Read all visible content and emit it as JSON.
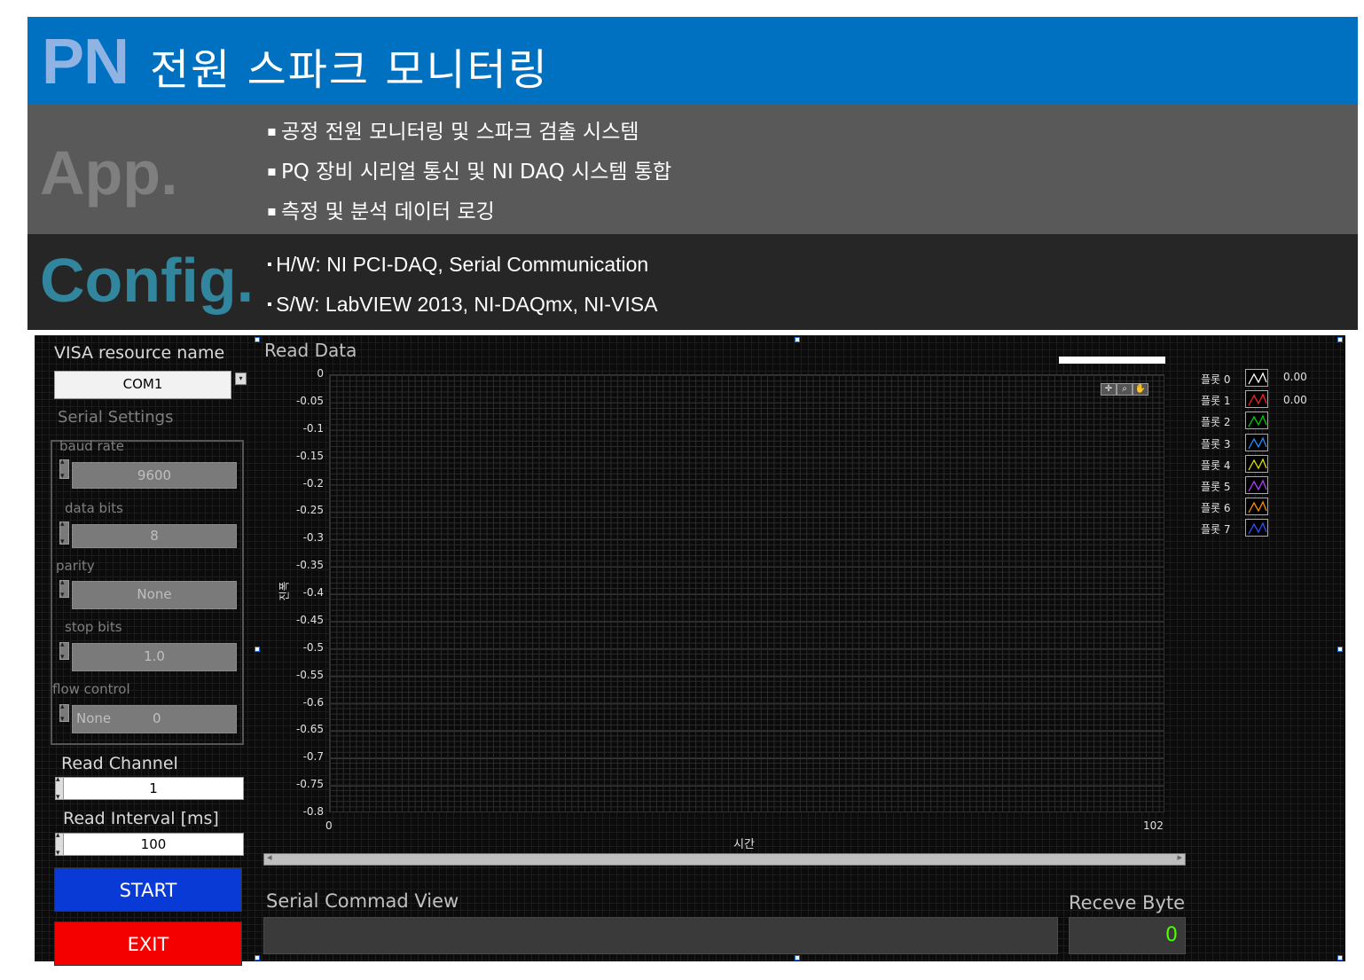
{
  "header": {
    "logo": "PN",
    "title": "전원 스파크 모니터링"
  },
  "app": {
    "label": "App.",
    "bullets": [
      "공정 전원 모니터링 및 스파크 검출 시스템",
      "PQ 장비 시리얼 통신 및 NI DAQ 시스템 통합",
      "측정 및 분석 데이터 로깅"
    ]
  },
  "config": {
    "label": "Config.",
    "bullets": [
      "H/W: NI PCI-DAQ, Serial Communication",
      "S/W: LabVIEW 2013, NI-DAQmx, NI-VISA"
    ]
  },
  "visa": {
    "label": "VISA resource name",
    "value": "COM1"
  },
  "serial": {
    "title": "Serial Settings",
    "baud_label": "baud rate",
    "baud": "9600",
    "data_bits_label": "data bits",
    "data_bits": "8",
    "parity_label": "parity",
    "parity": "None",
    "stop_bits_label": "stop bits",
    "stop_bits": "1.0",
    "flow_label": "flow control",
    "flow": "None",
    "flow_num": "0"
  },
  "read_channel": {
    "label": "Read Channel",
    "value": "1"
  },
  "read_interval": {
    "label": "Read Interval [ms]",
    "value": "100"
  },
  "buttons": {
    "start": "START",
    "exit": "EXIT"
  },
  "graph": {
    "title": "Read Data"
  },
  "chart_data": {
    "type": "line",
    "title": "Read Data",
    "xlabel": "시간",
    "ylabel": "진폭",
    "xlim": [
      0,
      102
    ],
    "ylim": [
      -0.8,
      0
    ],
    "x_ticks": [
      "0",
      "102"
    ],
    "y_ticks": [
      "0",
      "-0.05",
      "-0.1",
      "-0.15",
      "-0.2",
      "-0.25",
      "-0.3",
      "-0.35",
      "-0.4",
      "-0.45",
      "-0.5",
      "-0.55",
      "-0.6",
      "-0.65",
      "-0.7",
      "-0.75",
      "-0.8"
    ],
    "grid": true,
    "legend_position": "right",
    "series": [
      {
        "name": "플롯 0",
        "color": "#ffffff",
        "values": []
      },
      {
        "name": "플롯 1",
        "color": "#ff2020",
        "values": []
      },
      {
        "name": "플롯 2",
        "color": "#00d000",
        "values": []
      },
      {
        "name": "플롯 3",
        "color": "#2090ff",
        "values": []
      },
      {
        "name": "플롯 4",
        "color": "#e0e000",
        "values": []
      },
      {
        "name": "플롯 5",
        "color": "#b040ff",
        "values": []
      },
      {
        "name": "플롯 6",
        "color": "#ff9000",
        "values": []
      },
      {
        "name": "플롯 7",
        "color": "#3050ff",
        "values": []
      }
    ],
    "readouts": [
      "0.00",
      "0.00"
    ]
  },
  "bottom": {
    "cmd_label": "Serial Commad View",
    "cmd_value": "",
    "receive_label": "Receve Byte",
    "receive_value": "0"
  }
}
